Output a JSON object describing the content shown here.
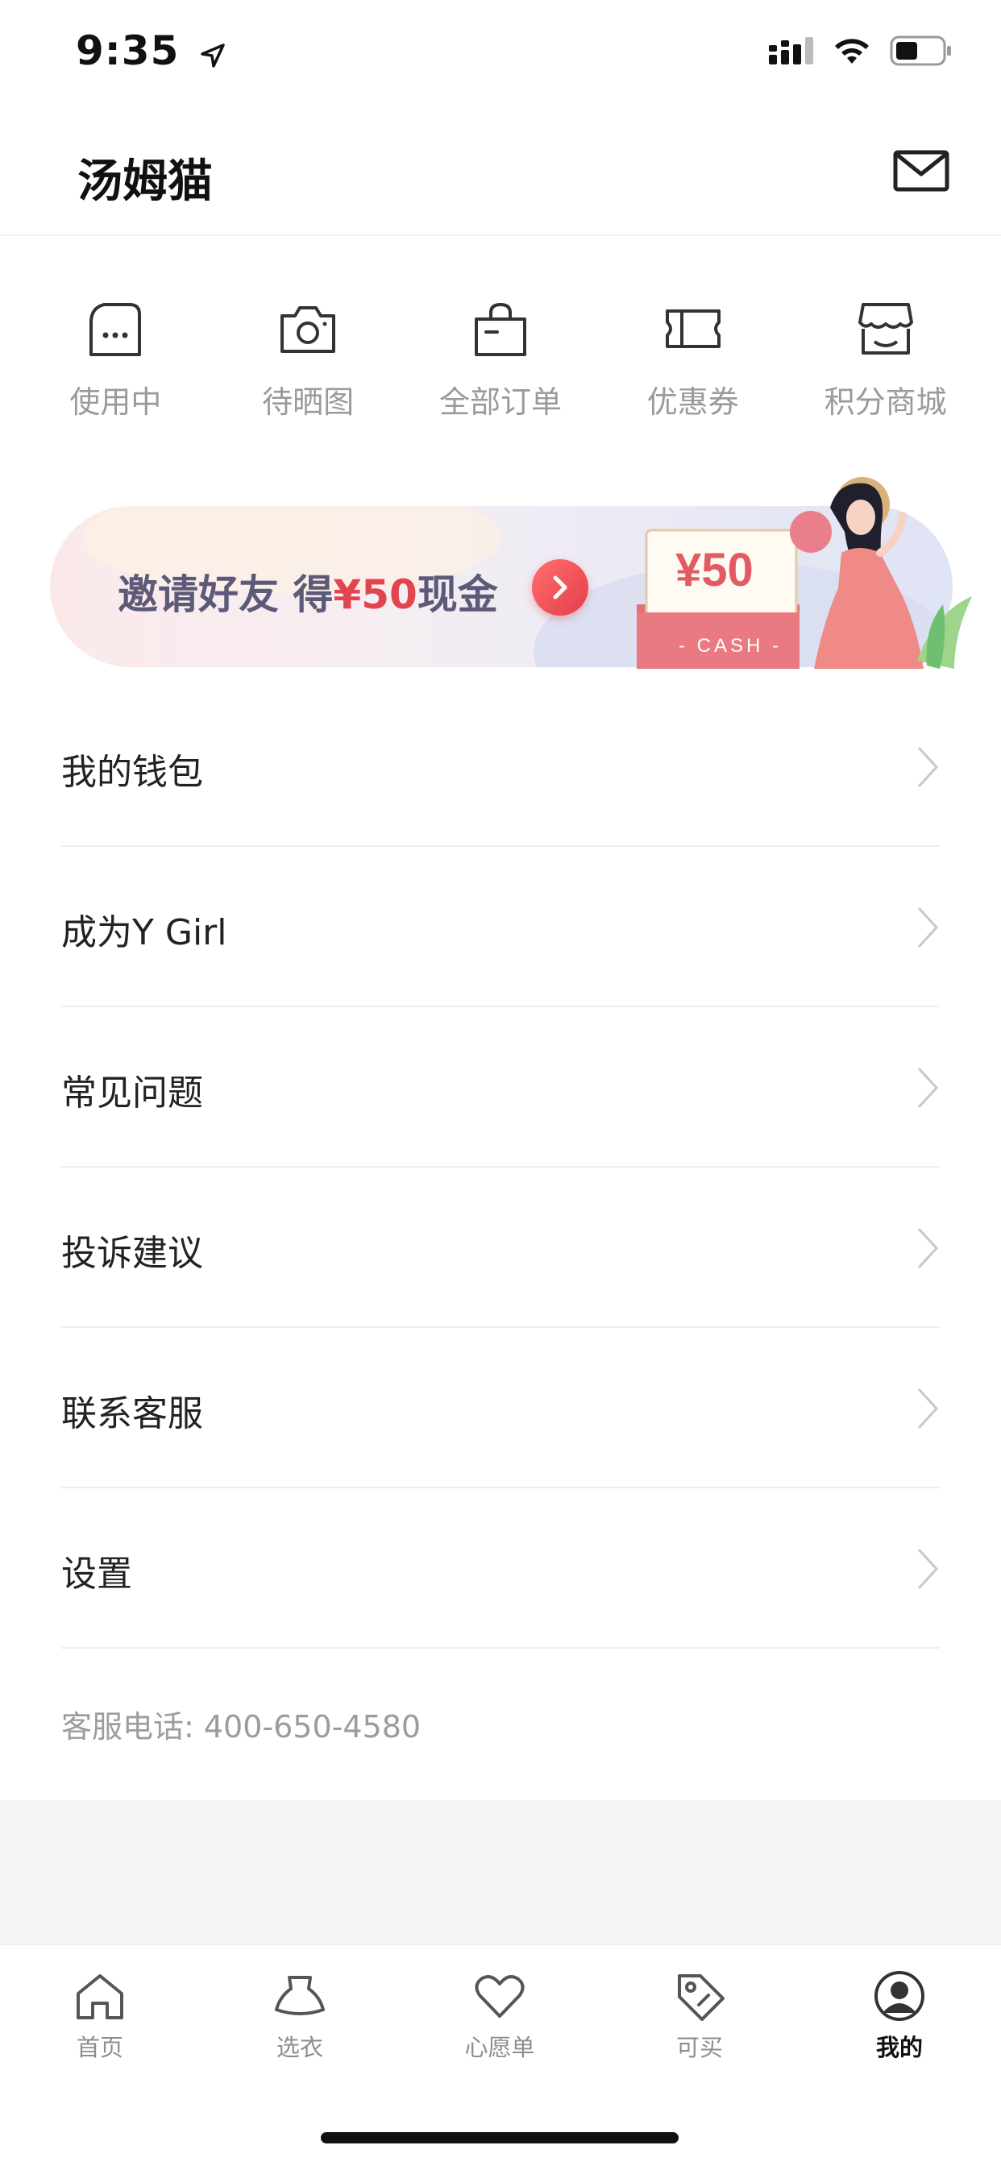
{
  "status_bar": {
    "time": "9:35"
  },
  "header": {
    "title": "汤姆猫"
  },
  "quick_actions": [
    {
      "label": "使用中",
      "icon": "in-use-bag-icon"
    },
    {
      "label": "待晒图",
      "icon": "camera-icon"
    },
    {
      "label": "全部订单",
      "icon": "shopping-bag-icon"
    },
    {
      "label": "优惠券",
      "icon": "ticket-icon"
    },
    {
      "label": "积分商城",
      "icon": "store-icon"
    }
  ],
  "banner": {
    "text_prefix": "邀请好友 得",
    "amount": "¥50",
    "text_suffix": "现金",
    "card_amount": "¥50",
    "card_label": "- CASH -"
  },
  "menu": [
    {
      "label": "我的钱包"
    },
    {
      "label": "成为Y Girl"
    },
    {
      "label": "常见问题"
    },
    {
      "label": "投诉建议"
    },
    {
      "label": "联系客服"
    },
    {
      "label": "设置"
    }
  ],
  "hotline": "客服电话: 400-650-4580",
  "tabs": [
    {
      "label": "首页",
      "icon": "home-icon"
    },
    {
      "label": "选衣",
      "icon": "dress-icon"
    },
    {
      "label": "心愿单",
      "icon": "heart-icon"
    },
    {
      "label": "可买",
      "icon": "tag-icon"
    },
    {
      "label": "我的",
      "icon": "profile-icon",
      "active": true
    }
  ],
  "colors": {
    "accent_red": "#e2454f",
    "banner_text": "#5c5a78",
    "muted_text": "#9a9a9a"
  }
}
